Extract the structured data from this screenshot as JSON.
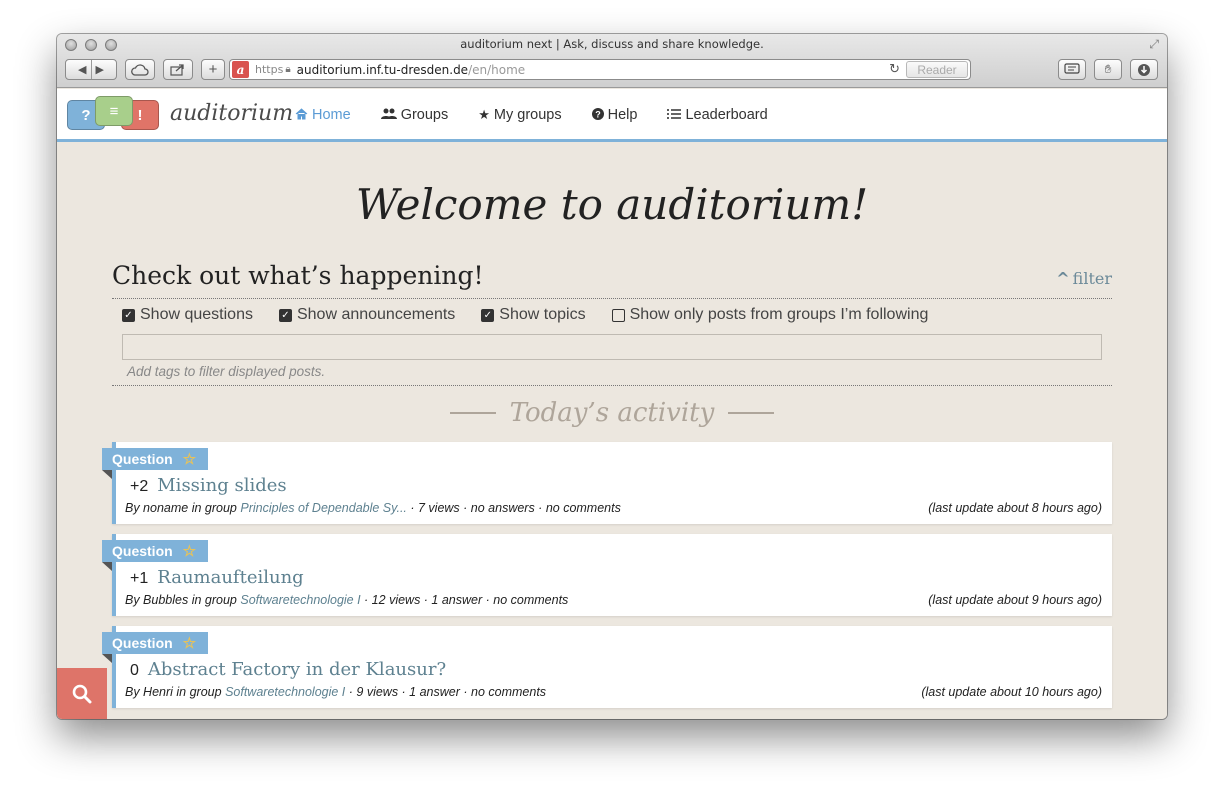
{
  "window": {
    "title": "auditorium next | Ask, discuss and share knowledge.",
    "url_scheme": "https",
    "url_host": "auditorium.inf.tu-dresden.de",
    "url_path": "/en/home",
    "reader_label": "Reader"
  },
  "site": {
    "brand": "auditorium",
    "logo_marks": [
      "?",
      "≡",
      "!"
    ],
    "accent_color": "#7fb2d9",
    "nav": [
      {
        "label": "Home",
        "icon": "home-icon",
        "active": true
      },
      {
        "label": "Groups",
        "icon": "users-icon",
        "active": false
      },
      {
        "label": "My groups",
        "icon": "star-icon",
        "active": false
      },
      {
        "label": "Help",
        "icon": "question-circle-icon",
        "active": false
      },
      {
        "label": "Leaderboard",
        "icon": "list-icon",
        "active": false
      }
    ]
  },
  "main": {
    "welcome": "Welcome to auditorium!",
    "section_title": "Check out what’s happening!",
    "filter_label": "filter",
    "checkboxes": [
      {
        "label": "Show questions",
        "checked": true
      },
      {
        "label": "Show announcements",
        "checked": true
      },
      {
        "label": "Show topics",
        "checked": true
      },
      {
        "label": "Show only posts from groups I’m following",
        "checked": false
      }
    ],
    "tags_help": "Add tags to filter displayed posts.",
    "activity_heading": "Today’s activity"
  },
  "posts": [
    {
      "type": "Question",
      "score": "+2",
      "title": "Missing slides",
      "by": "By noname in group ",
      "group": "Principles of Dependable Sy...",
      "stats": " · 7 views · no answers · no comments",
      "updated": "(last update about 8 hours ago)"
    },
    {
      "type": "Question",
      "score": "+1",
      "title": "Raumaufteilung",
      "by": "By Bubbles in group ",
      "group": "Softwaretechnologie I",
      "stats": " · 12 views · 1 answer · no comments",
      "updated": "(last update about 9 hours ago)"
    },
    {
      "type": "Question",
      "score": "0",
      "title": "Abstract Factory in der Klausur?",
      "by": "By Henri in group ",
      "group": "Softwaretechnologie I",
      "stats": " · 9 views · 1 answer · no comments",
      "updated": "(last update about 10 hours ago)"
    }
  ]
}
